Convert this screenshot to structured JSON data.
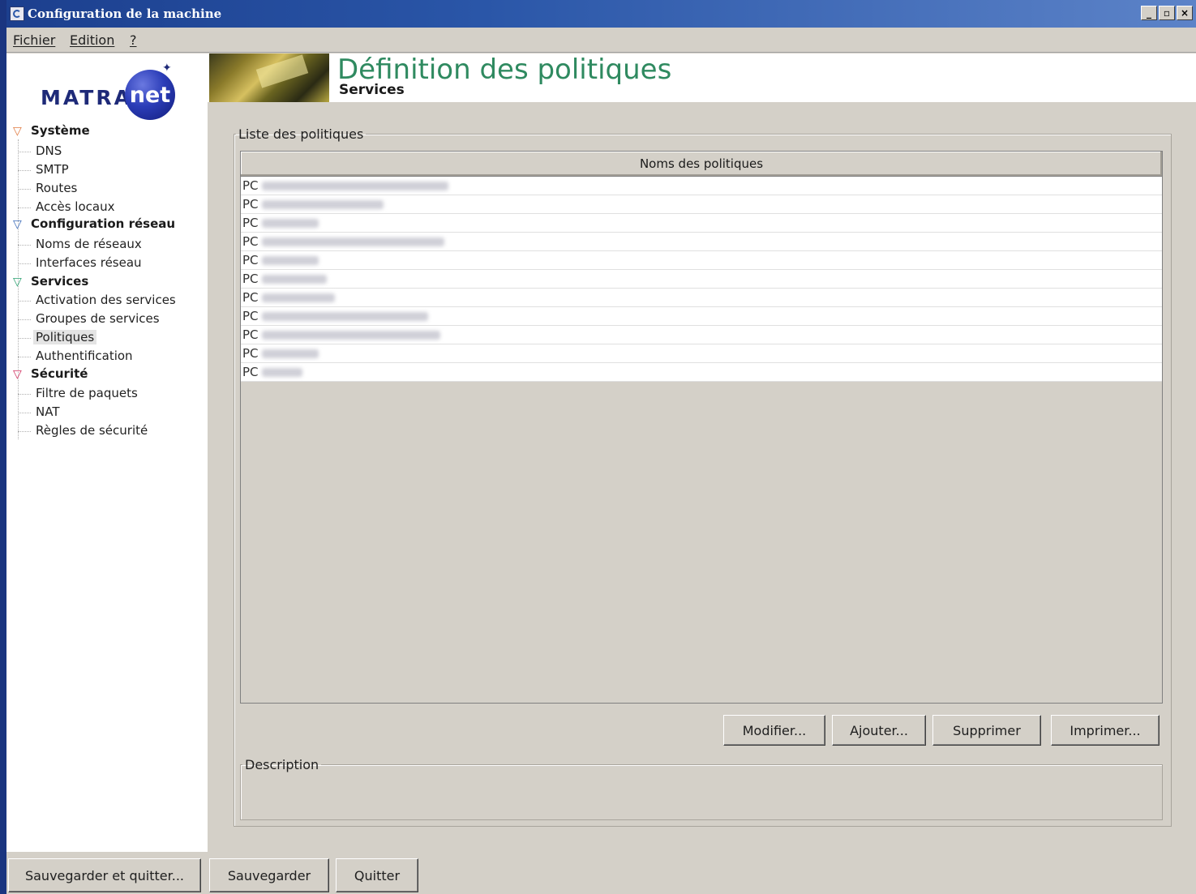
{
  "window": {
    "title": "Configuration de la machine",
    "controls": {
      "minimize": "_",
      "restore": "▫",
      "close": "×"
    }
  },
  "menubar": {
    "items": [
      "Fichier",
      "Edition",
      "?"
    ]
  },
  "logo": {
    "text": "MATRA",
    "ball_text": "net"
  },
  "sidebar": {
    "categories": [
      {
        "label": "Système",
        "color": "#e07a40",
        "items": [
          "DNS",
          "SMTP",
          "Routes",
          "Accès locaux"
        ]
      },
      {
        "label": "Configuration réseau",
        "color": "#3a6ab8",
        "items": [
          "Noms de réseaux",
          "Interfaces réseau"
        ]
      },
      {
        "label": "Services",
        "color": "#2aa070",
        "items": [
          "Activation des services",
          "Groupes de services",
          "Politiques",
          "Authentification"
        ]
      },
      {
        "label": "Sécurité",
        "color": "#d03060",
        "items": [
          "Filtre de paquets",
          "NAT",
          "Règles de sécurité"
        ]
      }
    ],
    "selected": "Politiques"
  },
  "header": {
    "title": "Définition des politiques",
    "subtitle": "Services"
  },
  "policies": {
    "group_label": "Liste des politiques",
    "column_header": "Noms des politiques",
    "rows": [
      "PC",
      "PC",
      "PC",
      "PC",
      "PC",
      "PC",
      "PC",
      "PC",
      "PC",
      "PC",
      "PC"
    ]
  },
  "actions": {
    "modify": "Modifier...",
    "add": "Ajouter...",
    "delete": "Supprimer",
    "print": "Imprimer..."
  },
  "description": {
    "label": "Description"
  },
  "footer": {
    "save_quit": "Sauvegarder et quitter...",
    "save": "Sauvegarder",
    "quit": "Quitter"
  }
}
